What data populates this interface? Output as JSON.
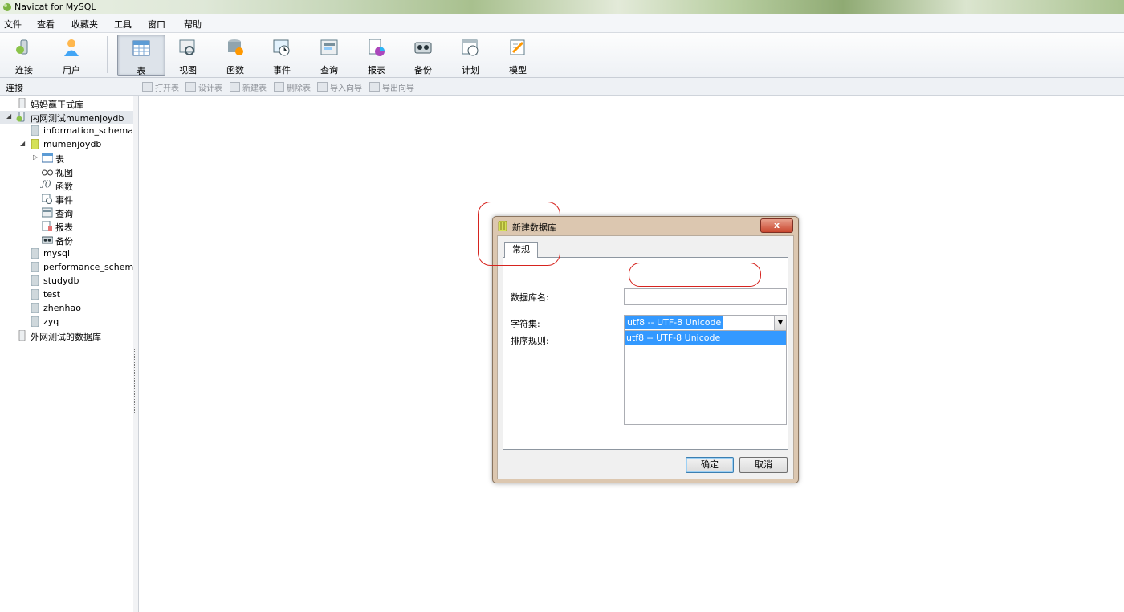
{
  "window": {
    "title": "Navicat for MySQL"
  },
  "menu": [
    "文件",
    "查看",
    "收藏夹",
    "工具",
    "窗口",
    "帮助"
  ],
  "toolbar": [
    {
      "label": "连接",
      "icon": "connection-icon"
    },
    {
      "label": "用户",
      "icon": "user-icon"
    },
    {
      "label": "表",
      "icon": "table-icon",
      "active": true
    },
    {
      "label": "视图",
      "icon": "view-icon"
    },
    {
      "label": "函数",
      "icon": "function-icon"
    },
    {
      "label": "事件",
      "icon": "event-icon"
    },
    {
      "label": "查询",
      "icon": "query-icon"
    },
    {
      "label": "报表",
      "icon": "report-icon"
    },
    {
      "label": "备份",
      "icon": "backup-icon"
    },
    {
      "label": "计划",
      "icon": "schedule-icon"
    },
    {
      "label": "模型",
      "icon": "model-icon"
    }
  ],
  "panel_header": "连接",
  "object_toolbar": [
    "打开表",
    "设计表",
    "新建表",
    "删除表",
    "导入向导",
    "导出向导"
  ],
  "tree": [
    {
      "label": "妈妈赢正式库"
    },
    {
      "label": "内网测试mumenjoydb"
    },
    {
      "label": "information_schema"
    },
    {
      "label": "mumenjoydb"
    },
    {
      "label": "表"
    },
    {
      "label": "视图"
    },
    {
      "label": "函数"
    },
    {
      "label": "事件"
    },
    {
      "label": "查询"
    },
    {
      "label": "报表"
    },
    {
      "label": "备份"
    },
    {
      "label": "mysql"
    },
    {
      "label": "performance_schema"
    },
    {
      "label": "studydb"
    },
    {
      "label": "test"
    },
    {
      "label": "zhenhao"
    },
    {
      "label": "zyq"
    },
    {
      "label": "外网测试的数据库"
    }
  ],
  "dialog": {
    "title": "新建数据库",
    "close": "x",
    "tab": "常规",
    "dbname_label": "数据库名:",
    "dbname_value": "",
    "charset_label": "字符集:",
    "charset_value": "utf8 -- UTF-8 Unicode",
    "collation_label": "排序规则:",
    "dropdown_option": "utf8 -- UTF-8 Unicode",
    "ok": "确定",
    "cancel": "取消"
  },
  "colors": {
    "highlight": "#3399ff",
    "annotation": "#d6241f"
  }
}
